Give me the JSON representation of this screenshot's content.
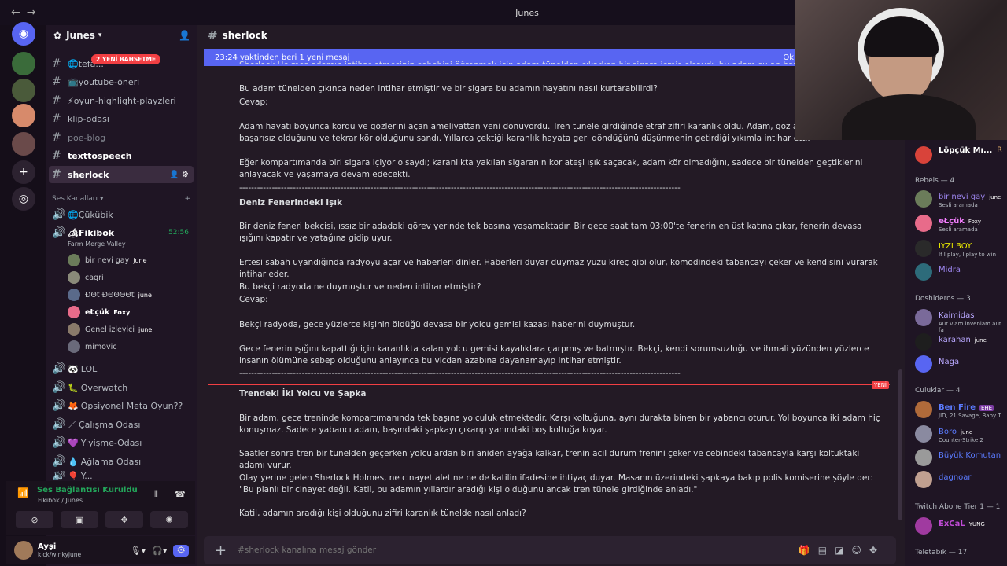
{
  "window": {
    "title": "Junes",
    "nav_back": "←",
    "nav_forward": "→"
  },
  "server": {
    "name": "Junes",
    "notification": "2 YENİ BAHSETME"
  },
  "channels": [
    {
      "name": "tefa...",
      "icon": "🌐"
    },
    {
      "name": "youtube-öneri",
      "icon": "📺"
    },
    {
      "name": "oyun-highlight-playzleri",
      "icon": "⚡"
    },
    {
      "name": "klip-odası",
      "icon": ""
    },
    {
      "name": "poe-blog",
      "icon": ""
    },
    {
      "name": "texttospeech",
      "icon": ""
    },
    {
      "name": "sherlock",
      "icon": ""
    }
  ],
  "voice_category": "Ses Kanalları",
  "voice_channels": [
    {
      "name": "Çükübik",
      "icon": "🌐"
    },
    {
      "name": "Fikibok",
      "icon": "🏕",
      "timer": "52:56",
      "sub": "Farm Merge Valley"
    }
  ],
  "voice_users": [
    {
      "name": "bir nevi gay",
      "tag": "june"
    },
    {
      "name": "cagri",
      "tag": ""
    },
    {
      "name": "ÐΘt ÐΘΘΘΘt",
      "tag": "june"
    },
    {
      "name": "eŁçük",
      "tag": "Foxy"
    },
    {
      "name": "Genel izleyici",
      "tag": "june"
    },
    {
      "name": "mimovic",
      "tag": ""
    }
  ],
  "voice_channels_2": [
    {
      "name": "LOL",
      "icon": "🐼"
    },
    {
      "name": "Overwatch",
      "icon": "🐛"
    },
    {
      "name": "Opsiyonel Meta Oyun??",
      "icon": "🦊"
    },
    {
      "name": "Çalışma Odası",
      "icon": "／"
    },
    {
      "name": "Yiyişme-Odası",
      "icon": "💜"
    },
    {
      "name": "Ağlama Odası",
      "icon": "💧"
    },
    {
      "name": "Y...",
      "icon": "🎈"
    }
  ],
  "voice_panel": {
    "status": "Ses Bağlantısı Kuruldu",
    "location": "Fikibok / Junes"
  },
  "user": {
    "name": "Ayşi",
    "status": "kick/winkyjune"
  },
  "channel": {
    "name": "sherlock"
  },
  "banner": {
    "text": "23:24 vaktinden beri 1 yeni mesaj",
    "right": "Ok"
  },
  "messages": [
    "Sherlock Holmes adamın intihar etmesinin sebebini öğrenmek için adam tünelden çıkarken bir sigara içmiş olsaydı, bu adam şu an hayatta olacaktı dedi",
    "Bu adam tünelden çıkınca neden intihar etmiştir ve bir sigara bu adamın hayatını nasıl kurtarabilirdi?",
    "Cevap:",
    "Adam hayatı boyunca kördü ve gözlerini açan ameliyattan yeni dönüyordu. Tren tünele girdiğinde etraf zifiri karanlık oldu. Adam, göz ameliyatının başarısız olduğunu ve tekrar kör olduğunu sandı. Yıllarca çektiği karanlık hayata geri döndüğünü düşünmenin getirdiği yıkımla intihar etti.",
    "Eğer kompartımanda biri sigara içiyor olsaydı; karanlıkta yakılan sigaranın kor ateşi ışık saçacak, adam kör olmadığını, sadece bir tünelden geçtiklerini anlayacak ve yaşamaya devam edecekti.",
    "----------------------------------------------------------------------------------------------------------------------------------------------------",
    "Deniz Fenerindeki Işık",
    "Bir deniz feneri bekçisi, ıssız bir adadaki görev yerinde tek başına yaşamaktadır. Bir gece saat tam 03:00'te fenerin en üst katına çıkar, fenerin devasa ışığını kapatır ve yatağına gidip uyur.",
    "Ertesi sabah uyandığında radyoyu açar ve haberleri dinler. Haberleri duyar duymaz yüzü kireç gibi olur, komodindeki tabancayı çeker ve kendisini vurarak intihar eder.",
    "Bu bekçi radyoda ne duymuştur ve neden intihar etmiştir?",
    "Cevap:",
    "Bekçi radyoda, gece yüzlerce kişinin öldüğü devasa bir yolcu gemisi kazası haberini duymuştur.",
    "Gece fenerin ışığını kapattığı için karanlıkta kalan yolcu gemisi kayalıklara çarpmış ve batmıştır. Bekçi, kendi sorumsuzluğu ve ihmali yüzünden yüzlerce insanın ölümüne sebep olduğunu anlayınca bu vicdan azabına dayanamayıp intihar etmiştir.",
    "----------------------------------------------------------------------------------------------------------------------------------------------------",
    "Trendeki İki Yolcu ve Şapka",
    "Bir adam, gece treninde kompartımanında tek başına yolculuk etmektedir. Karşı koltuğuna, aynı durakta binen bir yabancı oturur. Yol boyunca iki adam hiç konuşmaz. Sadece yabancı adam, başındaki şapkayı çıkarıp yanındaki boş koltuğa koyar.",
    "Saatler sonra tren bir tünelden geçerken yolculardan biri aniden ayağa kalkar, trenin acil durum frenini çeker ve cebindeki tabancayla karşı koltuktaki adamı vurur.",
    "Olay yerine gelen Sherlock Holmes, ne cinayet aletine ne de katilin ifadesine ihtiyaç duyar. Masanın üzerindeki şapkaya bakıp polis komiserine şöyle der: \"Bu planlı bir cinayet değil. Katil, bu adamın yıllardır aradığı kişi olduğunu ancak tren tünele girdiğinde anladı.\"",
    "Katil, adamın aradığı kişi olduğunu zifiri karanlık tünelde nasıl anladı?"
  ],
  "new_label": "YENİ",
  "composer": {
    "placeholder": "#sherlock kanalına mesaj gönder",
    "add": "+"
  },
  "members_top": {
    "name": "Löpçük Mı...",
    "extra": "R"
  },
  "member_groups": [
    {
      "header": "Rebels — 4",
      "members": [
        {
          "name": "bir nevi gay",
          "tag": "june",
          "status": "Sesli aramada",
          "color": "#9b84ec"
        },
        {
          "name": "eŁçük",
          "tag": "Foxy",
          "status": "Sesli aramada",
          "color": "#f47fff"
        },
        {
          "name": "IYZI BOY",
          "tag": "",
          "status": "If I play, I play to win",
          "color": "#e8e800"
        },
        {
          "name": "Midra",
          "tag": "",
          "status": "",
          "color": "#9b84ec"
        }
      ]
    },
    {
      "header": "Doshideros — 3",
      "members": [
        {
          "name": "Kaimidas",
          "tag": "",
          "status": "Aut viam inveniam aut fa",
          "color": "#b9a8ff"
        },
        {
          "name": "karahan",
          "tag": "june",
          "status": "",
          "color": "#b9a8ff"
        },
        {
          "name": "Naga",
          "tag": "",
          "status": "",
          "color": "#b9a8ff"
        }
      ]
    },
    {
      "header": "Culuklar — 4",
      "members": [
        {
          "name": "Ben Fire",
          "tag": "EHE",
          "status": "JID, 21 Savage, Baby T",
          "color": "#5b7bff"
        },
        {
          "name": "Boro",
          "tag": "june",
          "status": "Counter-Strike 2",
          "color": "#5b7bff"
        },
        {
          "name": "Büyük Komutan",
          "tag": "",
          "status": "",
          "color": "#5b7bff"
        },
        {
          "name": "dagnoar",
          "tag": "",
          "status": "",
          "color": "#5b7bff"
        }
      ]
    },
    {
      "header": "Twitch Abone Tier 1 — 1",
      "members": [
        {
          "name": "ExCaL",
          "tag": "YUNG",
          "status": "",
          "color": "#c04bd6"
        }
      ]
    },
    {
      "header": "Teletabik — 17",
      "members": []
    }
  ]
}
